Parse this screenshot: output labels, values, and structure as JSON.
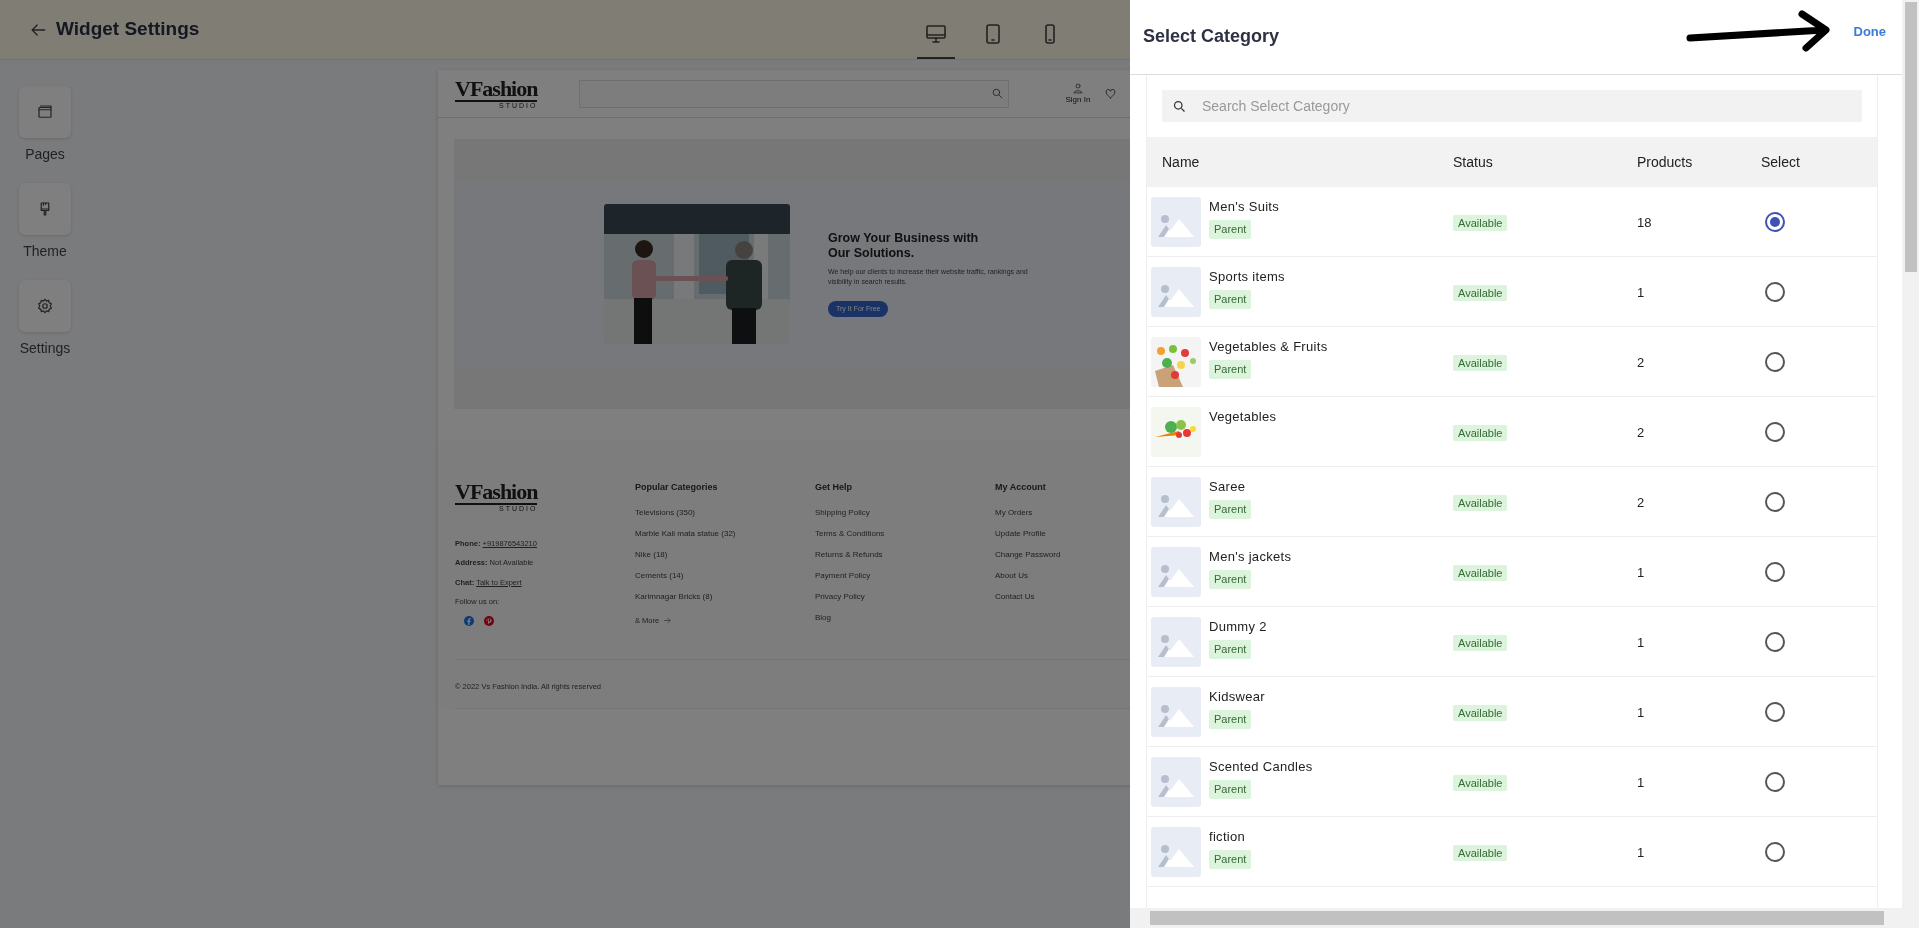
{
  "header": {
    "title": "Widget Settings",
    "devices": [
      {
        "kind": "desktop",
        "selected": true
      },
      {
        "kind": "tablet",
        "selected": false
      },
      {
        "kind": "mobile",
        "selected": false
      }
    ]
  },
  "sidebar": {
    "items": [
      {
        "kind": "pages",
        "label": "Pages"
      },
      {
        "kind": "theme",
        "label": "Theme"
      },
      {
        "kind": "settings",
        "label": "Settings"
      }
    ]
  },
  "preview": {
    "logo": {
      "name": "VFashion",
      "tagline": "STUDIO"
    },
    "user_label": "Sign In",
    "hero": {
      "heading": "Grow Your Business with Our Solutions.",
      "text": "We help our clients to increase their website traffic, rankings and visibility in search results.",
      "button": "Try It For Free"
    },
    "footer": {
      "logo": {
        "name": "VFashion",
        "tagline": "STUDIO"
      },
      "contacts": [
        {
          "label": "Phone:",
          "value": "+919876543210",
          "link": true
        },
        {
          "label": "Address:",
          "value": "Not Available",
          "link": false
        },
        {
          "label": "Chat:",
          "value": "Talk to Expert",
          "link": true
        }
      ],
      "follow": "Follow us on:",
      "social": [
        {
          "kind": "facebook"
        },
        {
          "kind": "pinterest"
        }
      ],
      "columns": [
        {
          "title": "Popular Categories",
          "links": [
            "Televisions (350)",
            "Marble Kali mata statue (32)",
            "Nike (18)",
            "Cements (14)",
            "Karimnagar Bricks (8)"
          ],
          "more": "& More"
        },
        {
          "title": "Get Help",
          "links": [
            "Shipping Policy",
            "Terms & Conditions",
            "Returns & Refunds",
            "Payment Policy",
            "Privacy Policy",
            "Blog"
          ]
        },
        {
          "title": "My Account",
          "links": [
            "My Orders",
            "Update Profile",
            "Change Password",
            "About Us",
            "Contact Us"
          ]
        }
      ],
      "copyright": "© 2022 Vs Fashion India. All rights reserved"
    }
  },
  "panel": {
    "title": "Select Category",
    "done": "Done",
    "search": {
      "placeholder": "Search Select Category"
    },
    "columns": [
      "Name",
      "Status",
      "Products",
      "Select"
    ],
    "rows": [
      {
        "name": "Men's Suits",
        "kind": "placeholder",
        "badge": "Parent",
        "status": "Available",
        "products": "18",
        "selected": true
      },
      {
        "name": "Sports items",
        "kind": "placeholder",
        "badge": "Parent",
        "status": "Available",
        "products": "1",
        "selected": false
      },
      {
        "name": "Vegetables & Fruits",
        "kind": "picture",
        "badge": "Parent",
        "status": "Available",
        "products": "2",
        "selected": false
      },
      {
        "name": "Vegetables",
        "kind": "picture",
        "status": "Available",
        "products": "2",
        "selected": false
      },
      {
        "name": "Saree",
        "kind": "placeholder",
        "badge": "Parent",
        "status": "Available",
        "products": "2",
        "selected": false
      },
      {
        "name": "Men's jackets",
        "kind": "placeholder",
        "badge": "Parent",
        "status": "Available",
        "products": "1",
        "selected": false
      },
      {
        "name": "Dummy 2",
        "kind": "placeholder",
        "badge": "Parent",
        "status": "Available",
        "products": "1",
        "selected": false
      },
      {
        "name": "Kidswear",
        "kind": "placeholder",
        "badge": "Parent",
        "status": "Available",
        "products": "1",
        "selected": false
      },
      {
        "name": "Scented Candles",
        "kind": "placeholder",
        "badge": "Parent",
        "status": "Available",
        "products": "1",
        "selected": false
      },
      {
        "name": "fiction",
        "kind": "placeholder",
        "badge": "Parent",
        "status": "Available",
        "products": "1",
        "selected": false
      }
    ]
  }
}
